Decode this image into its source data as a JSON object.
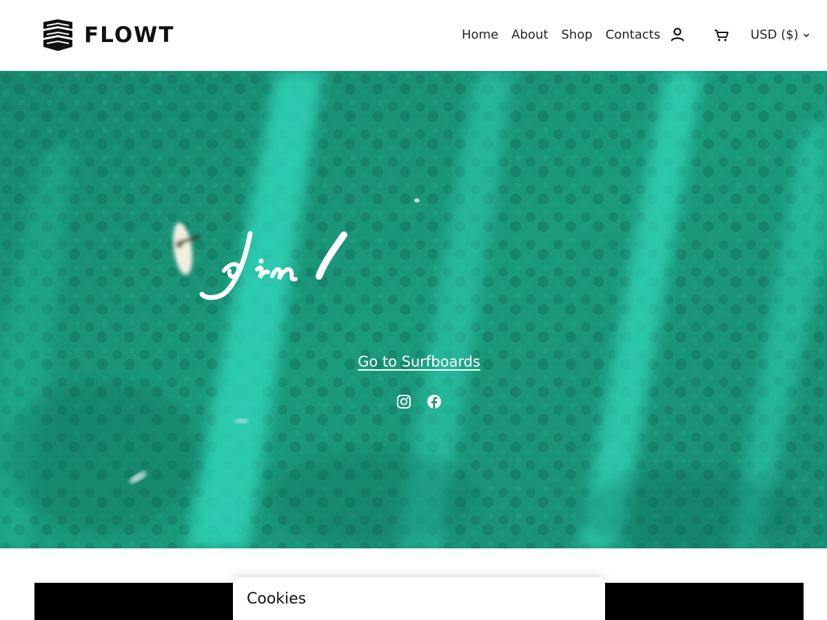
{
  "brand": {
    "name": "FLOWT",
    "logo_icon": "chevron-stack-logo"
  },
  "nav": {
    "items": [
      {
        "label": "Home"
      },
      {
        "label": "About"
      },
      {
        "label": "Shop"
      },
      {
        "label": "Contacts"
      }
    ],
    "account_icon": "user-icon",
    "cart_icon": "cart-icon",
    "currency": {
      "label": "USD ($)",
      "icon": "chevron-down-icon"
    }
  },
  "hero": {
    "background": "aerial ocean with surfer",
    "script_heading": "Join (",
    "link_label": "Go to Surfboards",
    "social_icons": [
      "instagram-icon",
      "facebook-icon"
    ]
  },
  "cookie": {
    "title": "Cookies"
  },
  "colors": {
    "header_bg": "#ffffff",
    "text": "#222222",
    "ocean": "#1a8f75",
    "ocean_light": "#2fe0c0",
    "band": "#000000"
  }
}
